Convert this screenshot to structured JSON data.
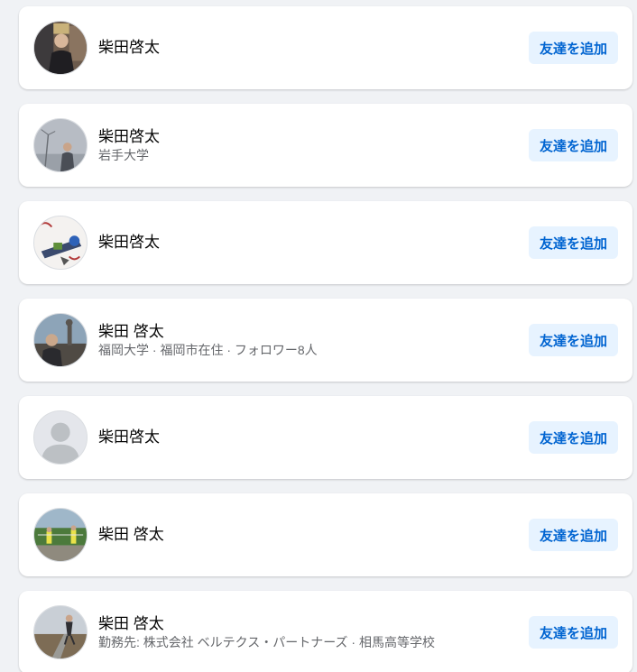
{
  "results": [
    {
      "name": "柴田啓太",
      "subtitle": "",
      "button": "友達を追加",
      "avatar_icon": "profile-photo"
    },
    {
      "name": "柴田啓太",
      "subtitle": "岩手大学",
      "button": "友達を追加",
      "avatar_icon": "profile-photo"
    },
    {
      "name": "柴田啓太",
      "subtitle": "",
      "button": "友達を追加",
      "avatar_icon": "profile-photo"
    },
    {
      "name": "柴田 啓太",
      "subtitle": "福岡大学 · 福岡市在住 · フォロワー8人",
      "button": "友達を追加",
      "avatar_icon": "profile-photo"
    },
    {
      "name": "柴田啓太",
      "subtitle": "",
      "button": "友達を追加",
      "avatar_icon": "default-user-icon"
    },
    {
      "name": "柴田 啓太",
      "subtitle": "",
      "button": "友達を追加",
      "avatar_icon": "profile-photo"
    },
    {
      "name": "柴田 啓太",
      "subtitle": "勤務先: 株式会社 ベルテクス・パートナーズ · 相馬高等学校",
      "button": "友達を追加",
      "avatar_icon": "profile-photo"
    }
  ],
  "colors": {
    "page_bg": "#f0f2f5",
    "card_bg": "#ffffff",
    "button_bg": "#e7f3ff",
    "button_text": "#0064d1",
    "subtitle_text": "#65676b"
  }
}
